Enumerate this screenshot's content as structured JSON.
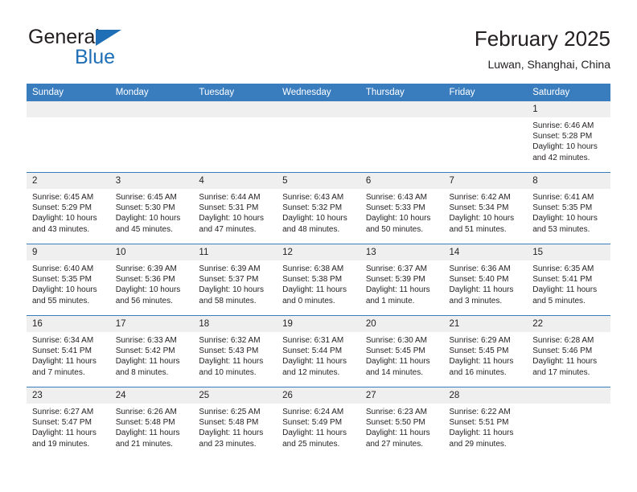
{
  "brand": {
    "name_part1": "General",
    "name_part2": "Blue",
    "accent_color": "#1f6fb6"
  },
  "header": {
    "title": "February 2025",
    "subtitle": "Luwan, Shanghai, China"
  },
  "calendar": {
    "header_bg": "#3a7dbf",
    "daynum_bg": "#efefef",
    "weekday_headers": [
      "Sunday",
      "Monday",
      "Tuesday",
      "Wednesday",
      "Thursday",
      "Friday",
      "Saturday"
    ],
    "weeks": [
      [
        {
          "day": "",
          "sunrise": "",
          "sunset": "",
          "daylight": ""
        },
        {
          "day": "",
          "sunrise": "",
          "sunset": "",
          "daylight": ""
        },
        {
          "day": "",
          "sunrise": "",
          "sunset": "",
          "daylight": ""
        },
        {
          "day": "",
          "sunrise": "",
          "sunset": "",
          "daylight": ""
        },
        {
          "day": "",
          "sunrise": "",
          "sunset": "",
          "daylight": ""
        },
        {
          "day": "",
          "sunrise": "",
          "sunset": "",
          "daylight": ""
        },
        {
          "day": "1",
          "sunrise": "Sunrise: 6:46 AM",
          "sunset": "Sunset: 5:28 PM",
          "daylight": "Daylight: 10 hours and 42 minutes."
        }
      ],
      [
        {
          "day": "2",
          "sunrise": "Sunrise: 6:45 AM",
          "sunset": "Sunset: 5:29 PM",
          "daylight": "Daylight: 10 hours and 43 minutes."
        },
        {
          "day": "3",
          "sunrise": "Sunrise: 6:45 AM",
          "sunset": "Sunset: 5:30 PM",
          "daylight": "Daylight: 10 hours and 45 minutes."
        },
        {
          "day": "4",
          "sunrise": "Sunrise: 6:44 AM",
          "sunset": "Sunset: 5:31 PM",
          "daylight": "Daylight: 10 hours and 47 minutes."
        },
        {
          "day": "5",
          "sunrise": "Sunrise: 6:43 AM",
          "sunset": "Sunset: 5:32 PM",
          "daylight": "Daylight: 10 hours and 48 minutes."
        },
        {
          "day": "6",
          "sunrise": "Sunrise: 6:43 AM",
          "sunset": "Sunset: 5:33 PM",
          "daylight": "Daylight: 10 hours and 50 minutes."
        },
        {
          "day": "7",
          "sunrise": "Sunrise: 6:42 AM",
          "sunset": "Sunset: 5:34 PM",
          "daylight": "Daylight: 10 hours and 51 minutes."
        },
        {
          "day": "8",
          "sunrise": "Sunrise: 6:41 AM",
          "sunset": "Sunset: 5:35 PM",
          "daylight": "Daylight: 10 hours and 53 minutes."
        }
      ],
      [
        {
          "day": "9",
          "sunrise": "Sunrise: 6:40 AM",
          "sunset": "Sunset: 5:35 PM",
          "daylight": "Daylight: 10 hours and 55 minutes."
        },
        {
          "day": "10",
          "sunrise": "Sunrise: 6:39 AM",
          "sunset": "Sunset: 5:36 PM",
          "daylight": "Daylight: 10 hours and 56 minutes."
        },
        {
          "day": "11",
          "sunrise": "Sunrise: 6:39 AM",
          "sunset": "Sunset: 5:37 PM",
          "daylight": "Daylight: 10 hours and 58 minutes."
        },
        {
          "day": "12",
          "sunrise": "Sunrise: 6:38 AM",
          "sunset": "Sunset: 5:38 PM",
          "daylight": "Daylight: 11 hours and 0 minutes."
        },
        {
          "day": "13",
          "sunrise": "Sunrise: 6:37 AM",
          "sunset": "Sunset: 5:39 PM",
          "daylight": "Daylight: 11 hours and 1 minute."
        },
        {
          "day": "14",
          "sunrise": "Sunrise: 6:36 AM",
          "sunset": "Sunset: 5:40 PM",
          "daylight": "Daylight: 11 hours and 3 minutes."
        },
        {
          "day": "15",
          "sunrise": "Sunrise: 6:35 AM",
          "sunset": "Sunset: 5:41 PM",
          "daylight": "Daylight: 11 hours and 5 minutes."
        }
      ],
      [
        {
          "day": "16",
          "sunrise": "Sunrise: 6:34 AM",
          "sunset": "Sunset: 5:41 PM",
          "daylight": "Daylight: 11 hours and 7 minutes."
        },
        {
          "day": "17",
          "sunrise": "Sunrise: 6:33 AM",
          "sunset": "Sunset: 5:42 PM",
          "daylight": "Daylight: 11 hours and 8 minutes."
        },
        {
          "day": "18",
          "sunrise": "Sunrise: 6:32 AM",
          "sunset": "Sunset: 5:43 PM",
          "daylight": "Daylight: 11 hours and 10 minutes."
        },
        {
          "day": "19",
          "sunrise": "Sunrise: 6:31 AM",
          "sunset": "Sunset: 5:44 PM",
          "daylight": "Daylight: 11 hours and 12 minutes."
        },
        {
          "day": "20",
          "sunrise": "Sunrise: 6:30 AM",
          "sunset": "Sunset: 5:45 PM",
          "daylight": "Daylight: 11 hours and 14 minutes."
        },
        {
          "day": "21",
          "sunrise": "Sunrise: 6:29 AM",
          "sunset": "Sunset: 5:45 PM",
          "daylight": "Daylight: 11 hours and 16 minutes."
        },
        {
          "day": "22",
          "sunrise": "Sunrise: 6:28 AM",
          "sunset": "Sunset: 5:46 PM",
          "daylight": "Daylight: 11 hours and 17 minutes."
        }
      ],
      [
        {
          "day": "23",
          "sunrise": "Sunrise: 6:27 AM",
          "sunset": "Sunset: 5:47 PM",
          "daylight": "Daylight: 11 hours and 19 minutes."
        },
        {
          "day": "24",
          "sunrise": "Sunrise: 6:26 AM",
          "sunset": "Sunset: 5:48 PM",
          "daylight": "Daylight: 11 hours and 21 minutes."
        },
        {
          "day": "25",
          "sunrise": "Sunrise: 6:25 AM",
          "sunset": "Sunset: 5:48 PM",
          "daylight": "Daylight: 11 hours and 23 minutes."
        },
        {
          "day": "26",
          "sunrise": "Sunrise: 6:24 AM",
          "sunset": "Sunset: 5:49 PM",
          "daylight": "Daylight: 11 hours and 25 minutes."
        },
        {
          "day": "27",
          "sunrise": "Sunrise: 6:23 AM",
          "sunset": "Sunset: 5:50 PM",
          "daylight": "Daylight: 11 hours and 27 minutes."
        },
        {
          "day": "28",
          "sunrise": "Sunrise: 6:22 AM",
          "sunset": "Sunset: 5:51 PM",
          "daylight": "Daylight: 11 hours and 29 minutes."
        },
        {
          "day": "",
          "sunrise": "",
          "sunset": "",
          "daylight": ""
        }
      ]
    ]
  }
}
